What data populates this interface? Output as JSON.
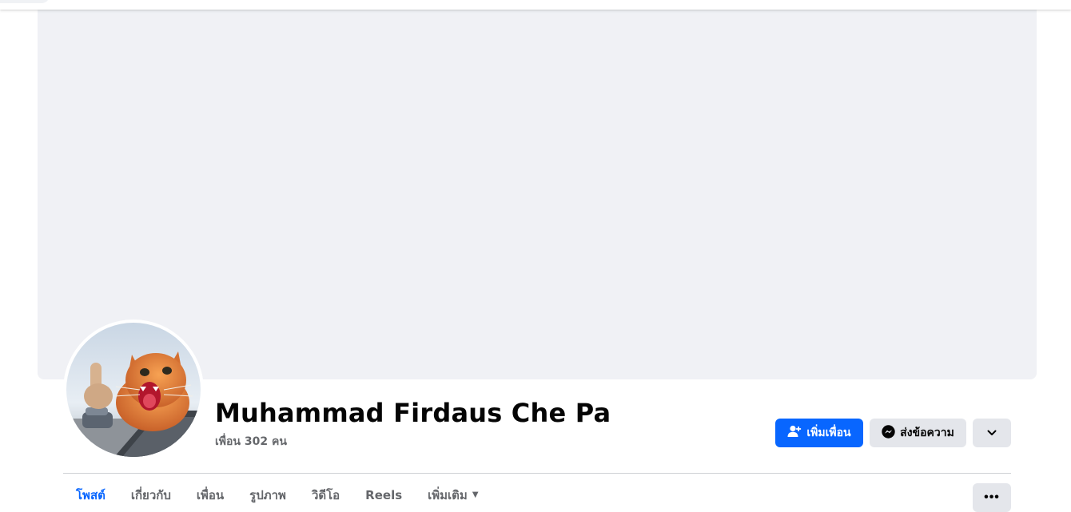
{
  "profile": {
    "name": "Muhammad Firdaus Che Pa",
    "friends_text": "เพื่อน 302 คน"
  },
  "actions": {
    "add_friend_label": "เพิ่มเพื่อน",
    "message_label": "ส่งข้อความ"
  },
  "tabs": [
    {
      "label": "โพสต์",
      "active": true
    },
    {
      "label": "เกี่ยวกับ",
      "active": false
    },
    {
      "label": "เพื่อน",
      "active": false
    },
    {
      "label": "รูปภาพ",
      "active": false
    },
    {
      "label": "วิดีโอ",
      "active": false
    },
    {
      "label": "Reels",
      "active": false
    },
    {
      "label": "เพิ่มเติม",
      "active": false
    }
  ],
  "icons": {
    "add_friend": "person-plus-icon",
    "messenger": "messenger-icon",
    "dropdown": "chevron-down-icon",
    "more_tab": "caret-down-icon",
    "overflow": "ellipsis-icon"
  },
  "colors": {
    "accent": "#0866ff",
    "secondary_button": "#e4e6eb",
    "cover": "#f0f1f5",
    "muted_text": "#65676b"
  }
}
